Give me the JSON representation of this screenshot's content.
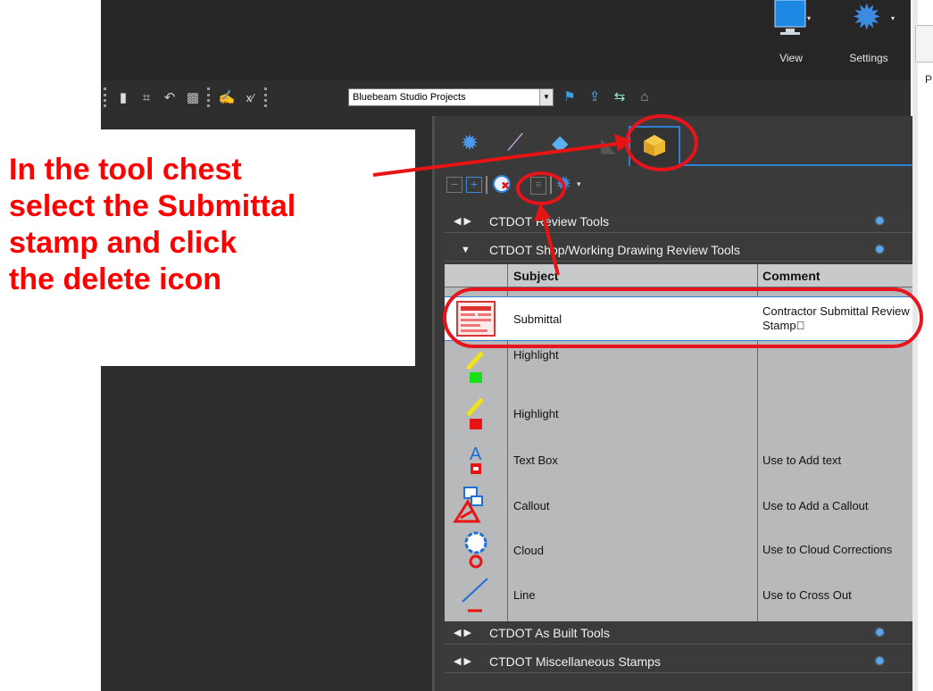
{
  "ribbon": {
    "view_label": "View",
    "settings_label": "Settings"
  },
  "toolbar": {
    "project_select_value": "Bluebeam Studio Projects"
  },
  "right_strip": {
    "char": "P"
  },
  "instruction": {
    "lines": [
      "In the tool chest",
      "select the Submittal",
      "stamp and click",
      "the delete icon"
    ],
    "color": "#ff0000"
  },
  "tool_chest": {
    "sections": [
      {
        "label": "CTDOT Review Tools",
        "expanded": false
      },
      {
        "label": "CTDOT Shop/Working Drawing Review Tools",
        "expanded": true
      },
      {
        "label": "CTDOT As Built Tools",
        "expanded": false
      },
      {
        "label": "CTDOT Miscellaneous Stamps",
        "expanded": false
      }
    ],
    "columns": {
      "subject": "Subject",
      "comment": "Comment"
    },
    "rows": [
      {
        "icon": "stamp-icon",
        "subject": "Submittal",
        "comment": "Contractor Submittal Review Stamp\u0000"
      },
      {
        "icon": "highlight-green-icon",
        "subject": "Highlight",
        "comment": ""
      },
      {
        "icon": "highlight-red-icon",
        "subject": "Highlight",
        "comment": ""
      },
      {
        "icon": "text-box-icon",
        "subject": "Text Box",
        "comment": "Use to Add text"
      },
      {
        "icon": "callout-icon",
        "subject": "Callout",
        "comment": "Use to Add a Callout"
      },
      {
        "icon": "cloud-icon",
        "subject": "Cloud",
        "comment": "Use to Cloud Corrections"
      },
      {
        "icon": "line-icon",
        "subject": "Line",
        "comment": "Use to Cross Out"
      }
    ],
    "accent_color": "#2f7fd3",
    "highlight_color": "#e8141c"
  }
}
